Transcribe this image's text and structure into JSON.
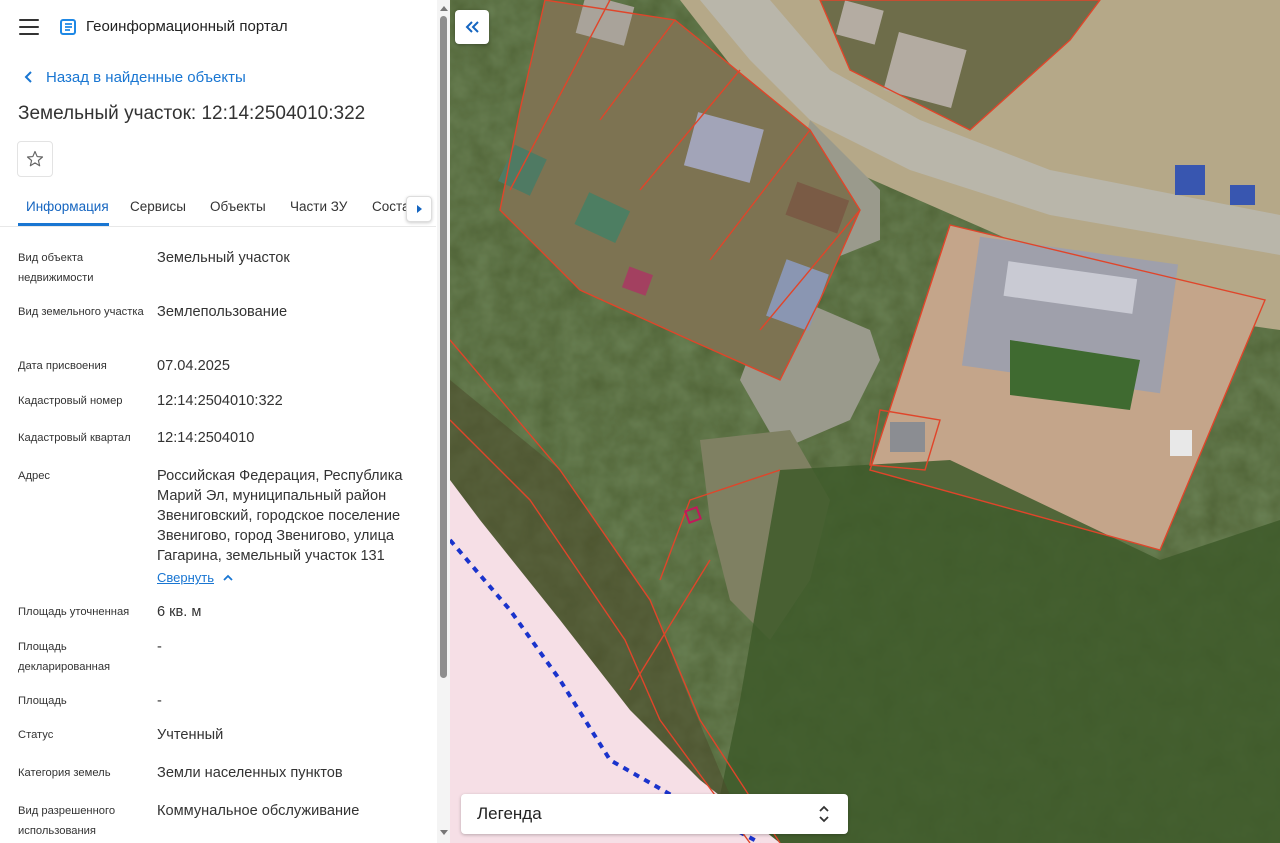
{
  "header": {
    "menu_icon": "hamburger-menu-icon",
    "logo_icon": "portal-logo-icon",
    "app_title": "Геоинформационный портал"
  },
  "nav": {
    "back_label": "Назад в найденные объекты"
  },
  "object": {
    "title": "Земельный участок: 12:14:2504010:322",
    "favorite_icon": "star-outline-icon"
  },
  "tabs": {
    "items": [
      {
        "label": "Информация",
        "active": true
      },
      {
        "label": "Сервисы"
      },
      {
        "label": "Объекты"
      },
      {
        "label": "Части ЗУ"
      },
      {
        "label": "Соста"
      }
    ],
    "next_icon": "caret-right-icon"
  },
  "properties": [
    {
      "label": "Вид объекта недвижимости",
      "value": "Земельный участок"
    },
    {
      "label": "Вид земельного участка",
      "value": "Землепользование"
    },
    {
      "label": "Дата присвоения",
      "value": "07.04.2025"
    },
    {
      "label": "Кадастровый номер",
      "value": "12:14:2504010:322"
    },
    {
      "label": "Кадастровый квартал",
      "value": "12:14:2504010"
    },
    {
      "label": "Адрес",
      "value": "Российская Федерация, Республика Марий Эл, муниципальный район Звениговский, городское поселение Звенигово, город Звенигово, улица Гагарина, земельный участок 131"
    },
    {
      "label": "Площадь уточненная",
      "value": "6 кв. м"
    },
    {
      "label": "Площадь декларированная",
      "value": "-"
    },
    {
      "label": "Площадь",
      "value": "-"
    },
    {
      "label": "Статус",
      "value": "Учтенный"
    },
    {
      "label": "Категория земель",
      "value": "Земли населенных пунктов"
    },
    {
      "label": "Вид разрешенного использования",
      "value": "Коммунальное обслуживание"
    }
  ],
  "address_collapse_label": "Свернуть",
  "map": {
    "collapse_panel_icon": "double-chevron-left-icon",
    "legend_label": "Легенда",
    "legend_toggle_icon": "chevron-up-down-icon",
    "colors": {
      "parcel_border": "#e0452a",
      "selected_parcel": "#c2185b",
      "boundary_line": "#1a33cc",
      "zone_fill": "#f6dfe6",
      "link": "#1976d2"
    }
  }
}
